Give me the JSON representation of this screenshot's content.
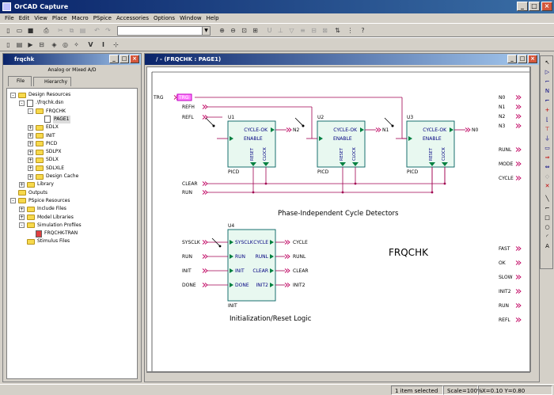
{
  "app": {
    "title": "OrCAD Capture"
  },
  "menu": [
    "File",
    "Edit",
    "View",
    "Place",
    "Macro",
    "PSpice",
    "Accessories",
    "Options",
    "Window",
    "Help"
  ],
  "project": {
    "title": "frqchk",
    "type_label": "Analog or Mixed A/D",
    "tabs": [
      "File",
      "Hierarchy"
    ],
    "tree": [
      {
        "label": "Design Resources",
        "level": 0,
        "exp": "-",
        "icon": "folder-icon"
      },
      {
        "label": ".\\frqchk.dsn",
        "level": 1,
        "exp": "-",
        "icon": "design-file-icon"
      },
      {
        "label": "FRQCHK",
        "level": 2,
        "exp": "-",
        "icon": "folder-icon"
      },
      {
        "label": "PAGE1",
        "level": 3,
        "exp": "",
        "icon": "schematic-page-icon"
      },
      {
        "label": "EDLX",
        "level": 2,
        "exp": "+",
        "icon": "folder-icon"
      },
      {
        "label": "INIT",
        "level": 2,
        "exp": "+",
        "icon": "folder-icon"
      },
      {
        "label": "PICD",
        "level": 2,
        "exp": "+",
        "icon": "folder-icon"
      },
      {
        "label": "SDLPX",
        "level": 2,
        "exp": "+",
        "icon": "folder-icon"
      },
      {
        "label": "SDLX",
        "level": 2,
        "exp": "+",
        "icon": "folder-icon"
      },
      {
        "label": "SDLXLE",
        "level": 2,
        "exp": "+",
        "icon": "folder-icon"
      },
      {
        "label": "Design Cache",
        "level": 2,
        "exp": "+",
        "icon": "folder-icon"
      },
      {
        "label": "Library",
        "level": 1,
        "exp": "+",
        "icon": "folder-icon"
      },
      {
        "label": "Outputs",
        "level": 0,
        "exp": "",
        "icon": "folder-icon"
      },
      {
        "label": "PSpice Resources",
        "level": 0,
        "exp": "-",
        "icon": "folder-icon"
      },
      {
        "label": "Include Files",
        "level": 1,
        "exp": "+",
        "icon": "folder-icon"
      },
      {
        "label": "Model Libraries",
        "level": 1,
        "exp": "+",
        "icon": "folder-icon"
      },
      {
        "label": "Simulation Profiles",
        "level": 1,
        "exp": "-",
        "icon": "folder-icon"
      },
      {
        "label": "FRQCHK-TRAN",
        "level": 2,
        "exp": "",
        "icon": "sim-profile-icon"
      },
      {
        "label": "Stimulus Files",
        "level": 1,
        "exp": "",
        "icon": "folder-icon"
      }
    ]
  },
  "schematic": {
    "title": "/ - (FRQCHK : PAGE1)",
    "sheet_title": "FRQCHK",
    "caption_top": "Phase-Independent Cycle Detectors",
    "caption_bottom": "Initialization/Reset Logic",
    "left_ports": [
      "TRG",
      "REFH",
      "REFL"
    ],
    "bus_ports": [
      "CLEAR",
      "RUN"
    ],
    "right_ports_top": [
      "N0",
      "N1",
      "N2",
      "N3"
    ],
    "right_ports_mid": [
      "RUNL",
      "MODE",
      "CYCLE"
    ],
    "right_ports_bottom": [
      "FAST",
      "OK",
      "SLOW",
      "INIT2",
      "RUN",
      "REFL"
    ],
    "detectors": [
      {
        "ref": "U1",
        "name": "PICD",
        "pin_out": "CYCLE-OK",
        "pin_en": "ENABLE",
        "pin_reset": "RESET",
        "pin_clock": "CLOCK",
        "net": "N2"
      },
      {
        "ref": "U2",
        "name": "PICD",
        "pin_out": "CYCLE-OK",
        "pin_en": "ENABLE",
        "pin_reset": "RESET",
        "pin_clock": "CLOCK",
        "net": "N1"
      },
      {
        "ref": "U3",
        "name": "PICD",
        "pin_out": "CYCLE-OK",
        "pin_en": "ENABLE",
        "pin_reset": "RESET",
        "pin_clock": "CLOCK",
        "net": "N0"
      }
    ],
    "init_block": {
      "ref": "U4",
      "name": "INIT",
      "inputs": [
        "SYSCLK",
        "RUN",
        "INIT",
        "DONE"
      ],
      "in_pins": [
        "SYSCLK",
        "RUN",
        "INIT",
        "DONE"
      ],
      "out_pins": [
        "CYCLE",
        "RUNL",
        "CLEAR",
        "INIT2"
      ],
      "outputs": [
        "CYCLE",
        "RUNL",
        "CLEAR",
        "INIT2"
      ]
    }
  },
  "status": {
    "selection": "1 item selected",
    "scale": "Scale=100%",
    "coords": "X=0.10  Y=0.80"
  },
  "colors": {
    "port": "#c00060",
    "wire": "#a00050",
    "part": "#006060",
    "body": "#e8f8f0",
    "pin": "#008040",
    "text": "#000080",
    "titlebar": "#0a246a"
  }
}
